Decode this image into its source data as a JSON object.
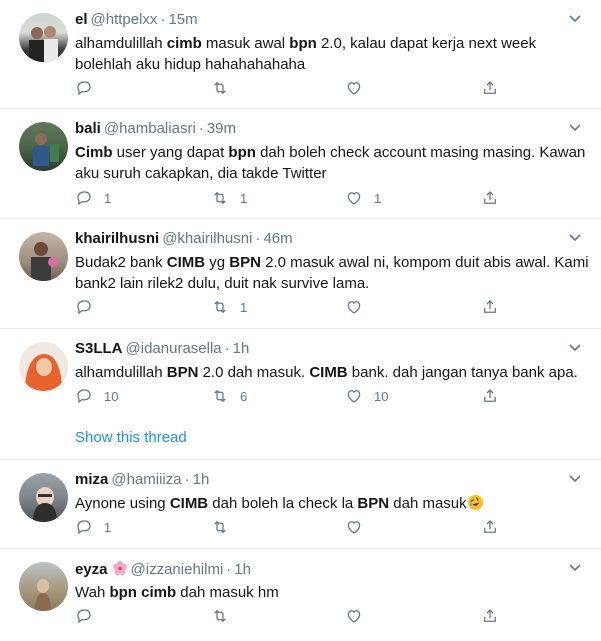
{
  "tweets": [
    {
      "name": "el",
      "handle": "@httpelxx",
      "sep": "·",
      "time": "15m",
      "text": [
        [
          "alhamdulillah ",
          false
        ],
        [
          "cimb",
          true
        ],
        [
          " masuk awal ",
          false
        ],
        [
          "bpn",
          true
        ],
        [
          " 2.0, kalau dapat kerja next week bolehlah aku hidup hahahahahaha",
          false
        ]
      ],
      "reply": "",
      "retweet": "",
      "like": ""
    },
    {
      "name": "bali",
      "handle": "@hambaliasri",
      "sep": "·",
      "time": "39m",
      "text": [
        [
          "Cimb",
          true
        ],
        [
          " user yang dapat ",
          false
        ],
        [
          "bpn",
          true
        ],
        [
          " dah boleh check account masing masing. Kawan aku suruh cakapkan, dia takde Twitter",
          false
        ]
      ],
      "reply": "1",
      "retweet": "1",
      "like": "1"
    },
    {
      "name": "khairilhusni",
      "handle": "@khairilhusni",
      "sep": "·",
      "time": "46m",
      "text": [
        [
          "Budak2 bank ",
          false
        ],
        [
          "CIMB",
          true
        ],
        [
          " yg ",
          false
        ],
        [
          "BPN",
          true
        ],
        [
          " 2.0 masuk awal ni, kompom duit abis awal. Kami bank2 lain rilek2 dulu, duit  nak survive lama.",
          false
        ]
      ],
      "reply": "",
      "retweet": "1",
      "like": ""
    },
    {
      "name": "S3LLA",
      "handle": "@idanurasella",
      "sep": "·",
      "time": "1h",
      "text": [
        [
          "alhamdulillah ",
          false
        ],
        [
          "BPN",
          true
        ],
        [
          " 2.0 dah masuk. ",
          false
        ],
        [
          "CIMB",
          true
        ],
        [
          " bank. dah jangan tanya bank apa.",
          false
        ]
      ],
      "reply": "10",
      "retweet": "6",
      "like": "10",
      "show_thread": "Show this thread"
    },
    {
      "name": "miza",
      "handle": "@hamiiiza",
      "sep": "·",
      "time": "1h",
      "text": [
        [
          "Aynone using ",
          false
        ],
        [
          "CIMB",
          true
        ],
        [
          " dah boleh la check la ",
          false
        ],
        [
          "BPN",
          true
        ],
        [
          " dah masuk",
          false
        ]
      ],
      "reply": "1",
      "retweet": "",
      "like": ""
    },
    {
      "name": "eyza",
      "handle": "@izzaniehilmi",
      "sep": "·",
      "time": "1h",
      "text": [
        [
          "Wah ",
          false
        ],
        [
          "bpn",
          true
        ],
        [
          " ",
          false
        ],
        [
          "cimb",
          true
        ],
        [
          " dah masuk hm",
          false
        ]
      ],
      "reply": "",
      "retweet": "",
      "like": ""
    }
  ],
  "icons": {
    "reply": "reply-icon",
    "retweet": "retweet-icon",
    "like": "like-icon",
    "share": "share-icon",
    "menu": "chevron-down-icon",
    "flower": "cherry-blossom-emoji",
    "laugh": "rolling-on-floor-laughing-emoji"
  },
  "colors": {
    "text": "#14171a",
    "secondary": "#657786",
    "link": "#1b95e0",
    "divider": "#e6ecf0"
  }
}
